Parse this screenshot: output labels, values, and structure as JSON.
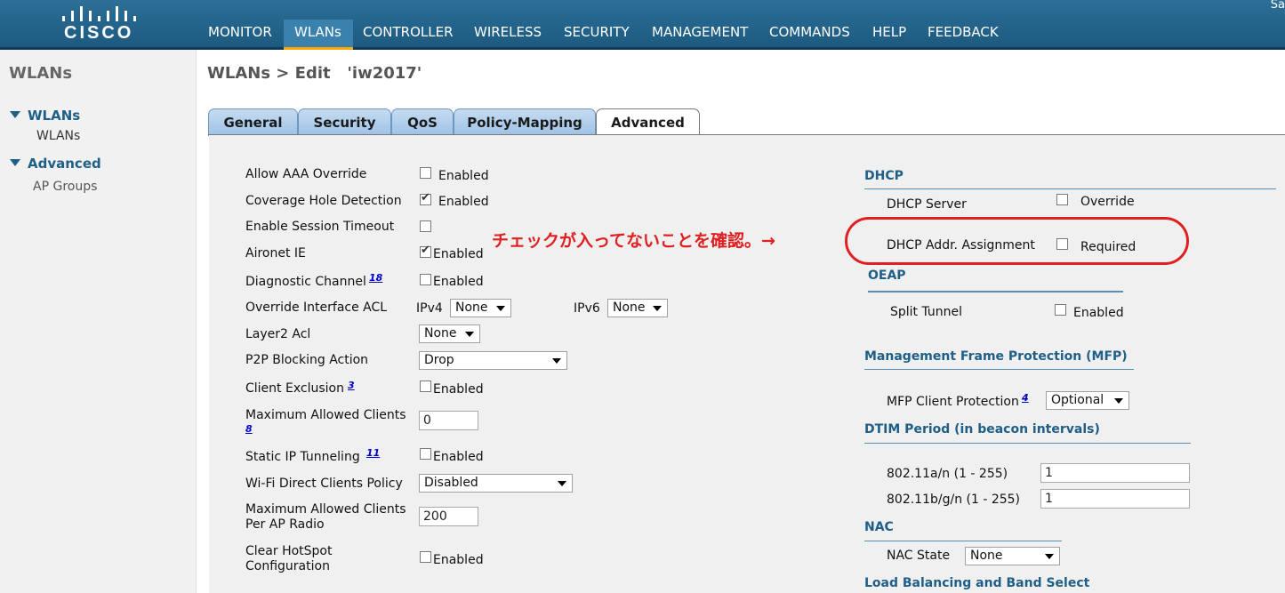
{
  "header": {
    "logo_text": "CISCO",
    "top_right_text": "Sa",
    "nav": [
      "MONITOR",
      "WLANs",
      "CONTROLLER",
      "WIRELESS",
      "SECURITY",
      "MANAGEMENT",
      "COMMANDS",
      "HELP",
      "FEEDBACK"
    ],
    "active_nav": "WLANs"
  },
  "sidebar": {
    "title": "WLANs",
    "groups": [
      {
        "label": "WLANs",
        "items": [
          "WLANs"
        ]
      },
      {
        "label": "Advanced",
        "items": [
          "AP Groups"
        ]
      }
    ]
  },
  "page_title": "WLANs > Edit   'iw2017'",
  "tabs": [
    "General",
    "Security",
    "QoS",
    "Policy-Mapping",
    "Advanced"
  ],
  "active_tab": "Advanced",
  "left_fields": {
    "allow_aaa": {
      "label": "Allow AAA Override",
      "checked": false,
      "text": "Enabled"
    },
    "coverage_hole": {
      "label": "Coverage Hole Detection",
      "checked": true,
      "text": "Enabled"
    },
    "session_timeout": {
      "label": "Enable Session Timeout",
      "checked": false
    },
    "aironet_ie": {
      "label": "Aironet IE",
      "checked": true,
      "text": "Enabled"
    },
    "diag_channel": {
      "label": "Diagnostic Channel",
      "footnote": "18",
      "checked": false,
      "text": "Enabled"
    },
    "override_acl": {
      "label": "Override Interface ACL",
      "ipv4_label": "IPv4",
      "ipv4_value": "None",
      "ipv6_label": "IPv6",
      "ipv6_value": "None"
    },
    "layer2_acl": {
      "label": "Layer2 Acl",
      "value": "None"
    },
    "p2p_blocking": {
      "label": "P2P Blocking Action",
      "value": "Drop"
    },
    "client_exclusion": {
      "label": "Client Exclusion",
      "footnote": "3",
      "checked": false,
      "text": "Enabled"
    },
    "max_clients": {
      "label_line1": "Maximum Allowed Clients",
      "footnote": "8",
      "value": "0"
    },
    "static_ip": {
      "label": "Static IP Tunneling",
      "footnote": "11",
      "checked": false,
      "text": "Enabled"
    },
    "wifi_direct": {
      "label": "Wi-Fi Direct Clients Policy",
      "value": "Disabled"
    },
    "max_clients_radio": {
      "label_line1": "Maximum Allowed Clients",
      "label_line2": "Per AP Radio",
      "value": "200"
    },
    "clear_hotspot": {
      "label_line1": "Clear HotSpot",
      "label_line2": "Configuration",
      "checked": false,
      "text": "Enabled"
    }
  },
  "right": {
    "dhcp": {
      "title": "DHCP",
      "server_label": "DHCP Server",
      "server_checked": false,
      "server_text": "Override",
      "addr_label": "DHCP Addr. Assignment",
      "addr_checked": false,
      "addr_text": "Required"
    },
    "oeap": {
      "title": "OEAP",
      "split_label": "Split Tunnel",
      "split_checked": false,
      "split_text": "Enabled"
    },
    "mfp": {
      "title": "Management Frame Protection (MFP)",
      "client_label": "MFP Client Protection",
      "footnote": "4",
      "client_value": "Optional"
    },
    "dtim": {
      "title": "DTIM Period (in beacon intervals)",
      "a_label": "802.11a/n (1 - 255)",
      "a_value": "1",
      "bg_label": "802.11b/g/n (1 - 255)",
      "bg_value": "1"
    },
    "nac": {
      "title": "NAC",
      "state_label": "NAC State",
      "state_value": "None"
    },
    "lb": {
      "title": "Load Balancing and Band Select"
    }
  },
  "annotation": {
    "text": "チェックが入ってないことを確認。→",
    "color": "#e02020"
  },
  "colors": {
    "header": "#1d5a80",
    "section": "#1f5f87",
    "tab": "#9dc1e6",
    "active_underline": "#ffa800"
  }
}
